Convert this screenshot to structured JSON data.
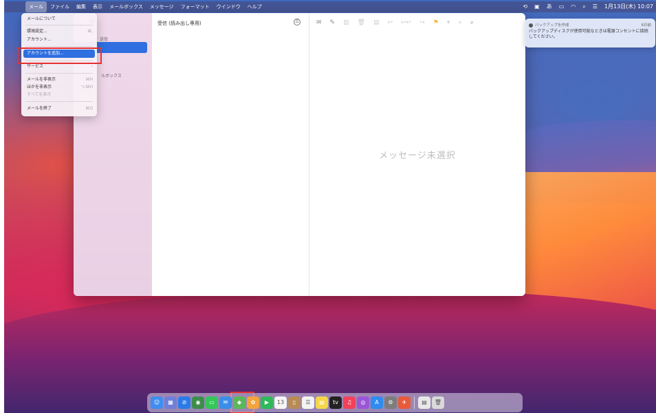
{
  "menubar": {
    "apple": "",
    "items": [
      "メール",
      "ファイル",
      "編集",
      "表示",
      "メールボックス",
      "メッセージ",
      "フォーマット",
      "ウインドウ",
      "ヘルプ"
    ],
    "clock": "1月13日(木) 10:07"
  },
  "app_menu": {
    "items": [
      {
        "label": "メールについて",
        "shortcut": ""
      },
      {
        "label": "環境設定...",
        "shortcut": "⌘,"
      },
      {
        "label": "アカウント...",
        "shortcut": ""
      },
      {
        "label": "アカウントを追加...",
        "shortcut": ""
      },
      {
        "label": "サービス",
        "shortcut": "›"
      },
      {
        "label": "メールを非表示",
        "shortcut": "⌘H"
      },
      {
        "label": "ほかを非表示",
        "shortcut": "⌥⌘H"
      },
      {
        "label": "すべてを表示",
        "shortcut": ""
      },
      {
        "label": "メールを終了",
        "shortcut": "⌘Q"
      }
    ]
  },
  "sidebar": {
    "partial_texts": [
      "送信",
      "ルボックス"
    ]
  },
  "list_pane": {
    "title": "受信 (読み出し専用)",
    "filter_icon": "☰"
  },
  "message_pane": {
    "empty_text": "メッセージ未選択",
    "toolbar": [
      "✉",
      "✎",
      "▥",
      "🗑",
      "▤",
      "↩",
      "↩↩",
      "↪",
      "⚑",
      "▾",
      "»",
      "⌕"
    ]
  },
  "notification": {
    "app": "バックアップを作成",
    "time": "8日前",
    "body": "バックアップディスクが使用可能なときは電源コンセントに接続してください。"
  },
  "dock": {
    "apps": [
      {
        "name": "finder",
        "color": "#3f8ef0",
        "glyph": "☺"
      },
      {
        "name": "launchpad",
        "color": "#6f7fd9",
        "glyph": "▦"
      },
      {
        "name": "safari",
        "color": "#2a7be8",
        "glyph": "⊘"
      },
      {
        "name": "chrome",
        "color": "#3c8e4a",
        "glyph": "◉"
      },
      {
        "name": "messages",
        "color": "#33c75a",
        "glyph": "▭"
      },
      {
        "name": "mail",
        "color": "#3a8ee8",
        "glyph": "✉"
      },
      {
        "name": "maps",
        "color": "#5bb85a",
        "glyph": "◆"
      },
      {
        "name": "photos",
        "color": "#f3a43b",
        "glyph": "✿"
      },
      {
        "name": "facetime",
        "color": "#2fb95a",
        "glyph": "▶"
      },
      {
        "name": "calendar",
        "color": "#f5f5f5",
        "glyph": "13"
      },
      {
        "name": "contacts",
        "color": "#b88a55",
        "glyph": "▯"
      },
      {
        "name": "reminders",
        "color": "#f3f3f3",
        "glyph": "☰"
      },
      {
        "name": "notes",
        "color": "#f5d64a",
        "glyph": "▤"
      },
      {
        "name": "tv",
        "color": "#222222",
        "glyph": "tv"
      },
      {
        "name": "music",
        "color": "#f2425a",
        "glyph": "♫"
      },
      {
        "name": "podcasts",
        "color": "#9b56d8",
        "glyph": "◎"
      },
      {
        "name": "appstore",
        "color": "#2f8cf0",
        "glyph": "A"
      },
      {
        "name": "settings",
        "color": "#7d7d7d",
        "glyph": "⚙"
      },
      {
        "name": "other",
        "color": "#e85a3a",
        "glyph": "✈"
      }
    ],
    "trash": [
      {
        "name": "document",
        "color": "#e8e8e8",
        "glyph": "▤"
      },
      {
        "name": "trash",
        "color": "#d9d9d9",
        "glyph": "🗑"
      }
    ]
  }
}
